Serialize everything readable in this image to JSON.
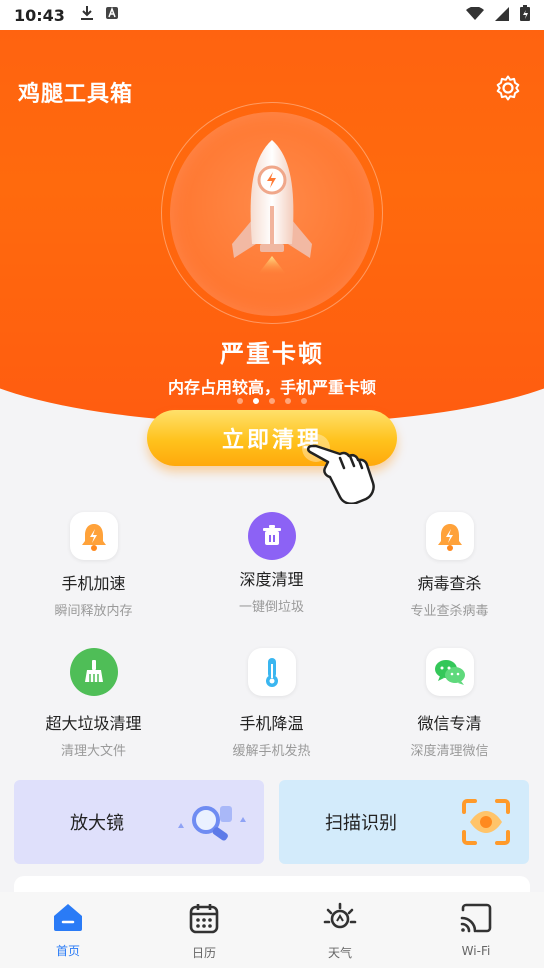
{
  "status_bar": {
    "time": "10:43"
  },
  "app_title": "鸡腿工具箱",
  "hero": {
    "status_title": "严重卡顿",
    "status_sub": "内存占用较高，手机严重卡顿",
    "dot_count": 5,
    "active_dot": 2
  },
  "clean_button": "立即清理",
  "tools": [
    {
      "name": "手机加速",
      "desc": "瞬间释放内存",
      "icon": "bell-bolt-icon"
    },
    {
      "name": "深度清理",
      "desc": "一键倒垃圾",
      "icon": "trash-icon"
    },
    {
      "name": "病毒查杀",
      "desc": "专业查杀病毒",
      "icon": "bell-bolt-icon"
    },
    {
      "name": "超大垃圾清理",
      "desc": "清理大文件",
      "icon": "broom-icon"
    },
    {
      "name": "手机降温",
      "desc": "缓解手机发热",
      "icon": "thermometer-icon"
    },
    {
      "name": "微信专清",
      "desc": "深度清理微信",
      "icon": "wechat-icon"
    }
  ],
  "cards": [
    {
      "label": "放大镜",
      "icon": "magnifier-icon"
    },
    {
      "label": "扫描识别",
      "icon": "scan-eye-icon"
    }
  ],
  "tabs": [
    {
      "label": "首页",
      "icon": "home-icon",
      "active": true
    },
    {
      "label": "日历",
      "icon": "calendar-icon",
      "active": false
    },
    {
      "label": "天气",
      "icon": "sun-icon",
      "active": false
    },
    {
      "label": "Wi-Fi",
      "icon": "cast-icon",
      "active": false
    }
  ],
  "colors": {
    "primary": "#ff5a14",
    "button": "#ffc21c",
    "tab_active": "#2a7bf6"
  }
}
